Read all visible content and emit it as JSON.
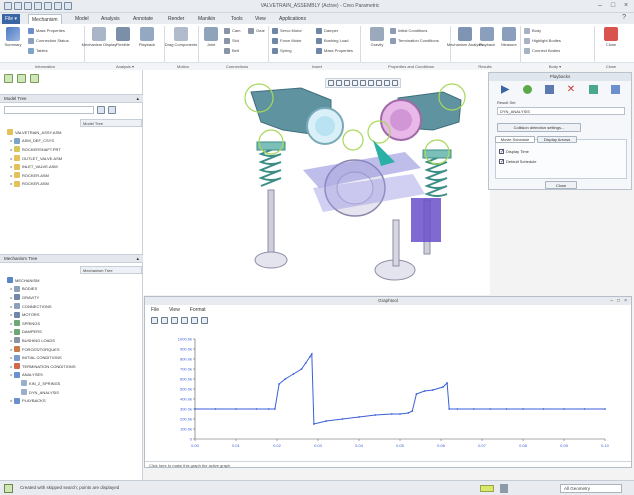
{
  "window": {
    "title": "VALVETRAIN_ASSEMBLY (Active) - Creo Parametric"
  },
  "tabs": [
    {
      "label": "File ▾"
    },
    {
      "label": "Mechanism"
    },
    {
      "label": "Model"
    },
    {
      "label": "Analysis"
    },
    {
      "label": "Annotate"
    },
    {
      "label": "Render"
    },
    {
      "label": "Manikin"
    },
    {
      "label": "Tools"
    },
    {
      "label": "View"
    },
    {
      "label": "Applications"
    }
  ],
  "ribbon": {
    "summary": "Summary",
    "mass_props": "Mass Properties",
    "connection_status": "Connection Status",
    "tables": "Tables",
    "servo": "Mechanism Display",
    "flexible": "Flexible",
    "playback": "Playback",
    "drag": "Drag Components",
    "snapshot": "Snapshot",
    "joint": "Joint",
    "cam": "Cam",
    "slot": "Slot",
    "belt": "Belt",
    "gear": "Gear",
    "servo_motor": "Servo Motor",
    "force_motor": "Force Motor",
    "spring": "Spring",
    "damper": "Damper",
    "bushing": "Bushing Load",
    "mass_props2": "Mass Properties",
    "gravity": "Gravity",
    "init_conditions": "Initial Conditions",
    "terminal": "Termination Conditions",
    "analysis_btn": "Mechanism Analysis",
    "results": "Playback",
    "measure": "Measure",
    "body": "Body",
    "body_highlight": "Highlight Bodies",
    "connect_body": "Connect Bodies",
    "close": "Close",
    "groups": {
      "information": "Information",
      "analysis": "Analysis ▾",
      "motion": "Motion",
      "connections": "Connections",
      "insert": "Insert",
      "properties": "Properties and Conditions",
      "results": "Results",
      "body": "Body ▾",
      "close": "Close"
    }
  },
  "left_panel": {
    "model_tree": {
      "header": "Model Tree",
      "col": "Model Tree",
      "items": [
        {
          "label": "VALVETRAIN_ASSY.ASM",
          "level": 0
        },
        {
          "label": "ASM_DEF_CSYS",
          "level": 1
        },
        {
          "label": "ROCKERSHAFT.PRT",
          "level": 1
        },
        {
          "label": "OUTLET_VALVE.ASM",
          "level": 1
        },
        {
          "label": "INLET_VALVE.ASM",
          "level": 1
        },
        {
          "label": "ROCKER.ASM",
          "level": 1
        },
        {
          "label": "ROCKER.ASM",
          "level": 1
        }
      ]
    },
    "mech_tree": {
      "header": "Mechanism Tree",
      "col": "Mechanism Tree",
      "items": [
        {
          "label": "MECHANISM",
          "level": 0
        },
        {
          "label": "BODIES",
          "level": 1
        },
        {
          "label": "GRAVITY",
          "level": 1
        },
        {
          "label": "CONNECTIONS",
          "level": 1
        },
        {
          "label": "MOTORS",
          "level": 1
        },
        {
          "label": "SPRINGS",
          "level": 1
        },
        {
          "label": "DAMPERS",
          "level": 1
        },
        {
          "label": "BUSHING LOADS",
          "level": 1
        },
        {
          "label": "FORCES/TORQUES",
          "level": 1
        },
        {
          "label": "INITIAL CONDITIONS",
          "level": 1
        },
        {
          "label": "TERMINATION CONDITIONS",
          "level": 1
        },
        {
          "label": "ANALYSES",
          "level": 1
        },
        {
          "label": "KIN_2_SPRINGS",
          "level": 2
        },
        {
          "label": "DYN_ANALYSIS",
          "level": 2
        },
        {
          "label": "PLAYBACKS",
          "level": 1
        }
      ]
    }
  },
  "dialog": {
    "title": "Playbacks",
    "field_label": "Result Set",
    "result_value": "DYN_ANALYSIS",
    "collision_btn": "Collision detection settings...",
    "tabs": [
      "Movie Schedule",
      "Display Arrows"
    ],
    "default_check": "Default Schedule",
    "display_check": "Display Time",
    "close": "Close"
  },
  "graph": {
    "title": "Graphtool",
    "menu": [
      "File",
      "View",
      "Format"
    ],
    "footer": "Click here to make this graph the active graph",
    "chart_data": {
      "type": "line",
      "title": "",
      "xlabel": "",
      "ylabel": "",
      "xticks": [
        "0.00",
        "0.01",
        "0.02",
        "0.03",
        "0.04",
        "0.05",
        "0.06",
        "0.07",
        "0.08",
        "0.09",
        "0.10"
      ],
      "yticks": [
        "0",
        "100.0k",
        "200.0k",
        "300.0k",
        "400.0k",
        "500.0k",
        "600.0k",
        "700.0k",
        "800.0k",
        "900.0k",
        "1000.0k"
      ],
      "xlim": [
        0,
        0.1
      ],
      "ylim": [
        0,
        1000000
      ],
      "color": "#3a5fd8",
      "x": [
        0.0,
        0.005,
        0.01,
        0.015,
        0.018,
        0.0195,
        0.0205,
        0.022,
        0.024,
        0.026,
        0.027,
        0.028,
        0.0285,
        0.029,
        0.032,
        0.036,
        0.04,
        0.044,
        0.048,
        0.05,
        0.052,
        0.053,
        0.054,
        0.056,
        0.058,
        0.0605,
        0.0615,
        0.062,
        0.064,
        0.068,
        0.072,
        0.076,
        0.08,
        0.085,
        0.09,
        0.095,
        0.1
      ],
      "y": [
        300000,
        300000,
        300000,
        300000,
        300000,
        300000,
        550000,
        600000,
        650000,
        700000,
        760000,
        820000,
        850000,
        150000,
        180000,
        200000,
        220000,
        240000,
        250000,
        250000,
        260000,
        280000,
        450000,
        480000,
        490000,
        520000,
        560000,
        300000,
        300000,
        300000,
        300000,
        300000,
        300000,
        300000,
        300000,
        300000,
        300000
      ]
    }
  },
  "status": {
    "message": "Created with skipped search; points are displayed",
    "filter": "All Geometry"
  }
}
